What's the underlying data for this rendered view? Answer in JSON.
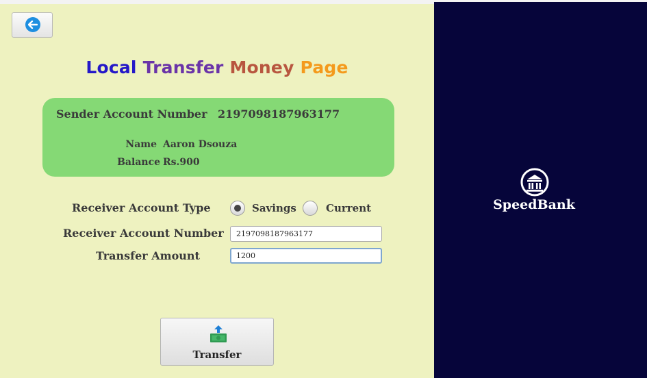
{
  "title": {
    "words": [
      "Local",
      "Transfer",
      "Money",
      "Page"
    ],
    "colors": [
      "#2418c8",
      "#6a34a8",
      "#b8563f",
      "#f49a1c"
    ]
  },
  "sender": {
    "account_label": "Sender Account Number",
    "account_number": "2197098187963177",
    "name_label": "Name",
    "name_value": "Aaron Dsouza",
    "balance_label": "Balance",
    "balance_value": "Rs.900"
  },
  "receiver": {
    "type_label": "Receiver Account Type",
    "type_options": [
      "Savings",
      "Current"
    ],
    "type_selected": "Savings",
    "account_label": "Receiver Account Number",
    "account_value": "2197098187963177",
    "amount_label": "Transfer Amount",
    "amount_value": "1200"
  },
  "buttons": {
    "back_icon": "arrow-left-icon",
    "transfer_label": "Transfer",
    "transfer_icon": "money-transfer-icon"
  },
  "brand": {
    "name": "SpeedBank",
    "icon": "bank-building-icon"
  },
  "colors": {
    "left_panel": "#eef2c0",
    "right_panel": "#06053a",
    "card": "#85d975",
    "back_circle": "#1e8fe0"
  }
}
